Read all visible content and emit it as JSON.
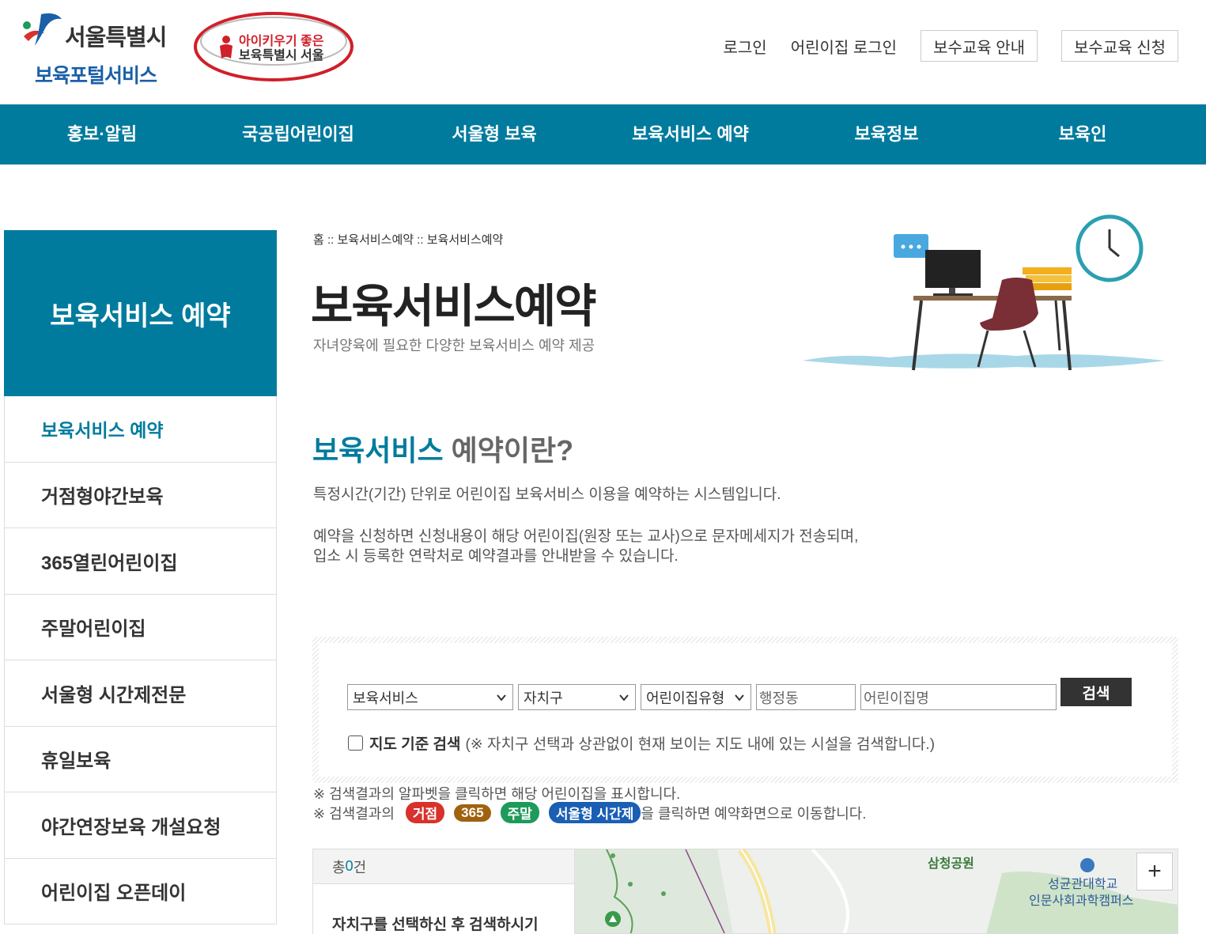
{
  "header": {
    "logo_line1": "서울특별시",
    "logo_line2": "보육포털서비스",
    "campaign_line1": "아이키우기 좋은",
    "campaign_line2": "보육특별시 서울",
    "links": {
      "login": "로그인",
      "daycare_login": "어린이집 로그인",
      "edu_info": "보수교육 안내",
      "edu_apply": "보수교육 신청"
    }
  },
  "gnb": [
    "홍보·알림",
    "국공립어린이집",
    "서울형 보육",
    "보육서비스 예약",
    "보육정보",
    "보육인"
  ],
  "sidebar": {
    "title": "보육서비스 예약",
    "items": [
      "보육서비스 예약",
      "거점형야간보육",
      "365열린어린이집",
      "주말어린이집",
      "서울형 시간제전문",
      "휴일보육",
      "야간연장보육 개설요청",
      "어린이집 오픈데이"
    ]
  },
  "main": {
    "breadcrumb": "홈 :: 보육서비스예약 :: 보육서비스예약",
    "title": "보육서비스예약",
    "subtitle": "자녀양육에 필요한 다양한 보육서비스 예약 제공",
    "section_title_hl": "보육서비스",
    "section_title_rest": " 예약이란?",
    "para1": "특정시간(기간) 단위로 어린이집 보육서비스 이용을 예약하는 시스템입니다.",
    "para2_line1": "예약을 신청하면 신청내용이 해당 어린이집(원장 또는 교사)으로 문자메세지가 전송되며,",
    "para2_line2": "입소 시 등록한 연락처로 예약결과를 안내받을 수 있습니다."
  },
  "search": {
    "service_select": "보육서비스",
    "district_select": "자치구",
    "type_select": "어린이집유형",
    "dong_placeholder": "행정동",
    "name_placeholder": "어린이집명",
    "button": "검색",
    "map_search_label": "지도 기준 검색",
    "map_search_desc": "(※ 자치구 선택과 상관없이 현재 보이는 지도 내에 있는 시설을 검색합니다.)"
  },
  "notes": {
    "note1": "※ 검색결과의 알파벳을 클릭하면 해당 어린이집을 표시합니다.",
    "note2_prefix": "※ 검색결과의",
    "note2_suffix": "을 클릭하면 예약화면으로 이동합니다.",
    "badges": [
      {
        "label": "거점",
        "color": "#d9312b"
      },
      {
        "label": "365",
        "color": "#a0620e"
      },
      {
        "label": "주말",
        "color": "#1e9a5a"
      },
      {
        "label": "서울형 시간제",
        "color": "#1a5fb4"
      }
    ]
  },
  "results": {
    "count_prefix": "총 ",
    "count_value": "0",
    "count_suffix": "건",
    "message": "자치구를 선택하신 후 검색하시기"
  },
  "map": {
    "labels": [
      "삼청공원",
      "성균관대학교",
      "인문사회과학캠퍼스"
    ],
    "zoom_in": "+"
  },
  "colors": {
    "primary": "#007b9e",
    "search_button": "#333333"
  }
}
